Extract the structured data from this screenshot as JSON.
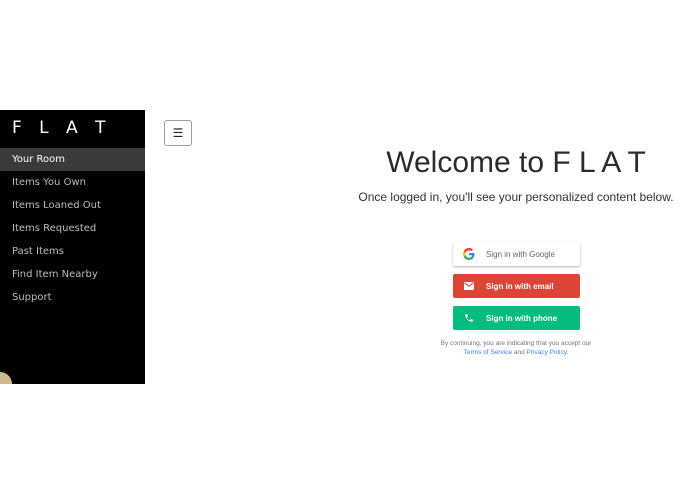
{
  "sidebar": {
    "brand": "F L A T",
    "items": [
      {
        "label": "Your Room"
      },
      {
        "label": "Items You Own"
      },
      {
        "label": "Items Loaned Out"
      },
      {
        "label": "Items Requested"
      },
      {
        "label": "Past Items"
      },
      {
        "label": "Find Item Nearby"
      },
      {
        "label": "Support"
      }
    ]
  },
  "header": {
    "menu_icon": "hamburger-icon",
    "menu_glyph": "☰"
  },
  "main": {
    "title": "Welcome to F L A T",
    "subtitle": "Once logged in, you'll see your personalized content below."
  },
  "auth": {
    "google_label": "Sign in with Google",
    "email_label": "Sign in with email",
    "phone_label": "Sign in with phone",
    "terms_prefix": "By continuing, you are indicating that you accept our",
    "terms_link": "Terms of Service",
    "terms_and": "and",
    "privacy_link": "Privacy Policy",
    "terms_suffix": "."
  },
  "colors": {
    "email": "#db4437",
    "phone": "#02bd7e",
    "link": "#4285f4",
    "sidebar_bg": "#000000"
  }
}
